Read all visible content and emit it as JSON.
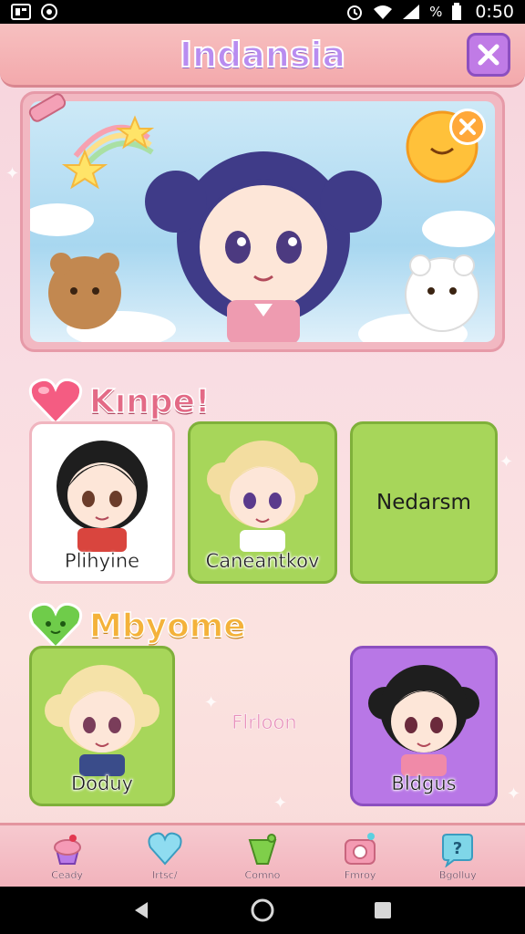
{
  "status_bar": {
    "battery_percent": "%",
    "time": "0:50",
    "icons": [
      "sim-icon",
      "app-icon",
      "alarm-icon",
      "wifi-icon",
      "signal-icon",
      "battery-icon"
    ]
  },
  "header": {
    "title": "Indansia",
    "close_icon": "close-icon"
  },
  "hero": {
    "close_icon": "close-icon"
  },
  "sections": [
    {
      "title": "Kınpe!",
      "icon": "heart-icon",
      "cards": [
        {
          "label": "Plihyine",
          "color": "#ffffff"
        },
        {
          "label": "Caneantkov",
          "color": "#a7d65a"
        },
        {
          "label": "Nedarsm",
          "color": "#a7d65a"
        }
      ]
    },
    {
      "title": "Mbyome",
      "icon": "green-heart-icon",
      "cards": [
        {
          "label": "Doduy",
          "color": "#a7d65a"
        },
        {
          "label": "Bldgus",
          "color": "#b877e6"
        }
      ],
      "middle_label": "Flrloon"
    }
  ],
  "tabs": [
    {
      "label": "Ceady",
      "icon": "cupcake-icon"
    },
    {
      "label": "Irtsc/",
      "icon": "heart-icon"
    },
    {
      "label": "Comno",
      "icon": "drink-icon"
    },
    {
      "label": "Fmroy",
      "icon": "camera-icon"
    },
    {
      "label": "Bgolluy",
      "icon": "help-icon"
    }
  ],
  "colors": {
    "accent_purple": "#b88cf0",
    "card_green": "#a7d65a",
    "card_purple": "#b877e6",
    "pink": "#f3a9ac"
  }
}
